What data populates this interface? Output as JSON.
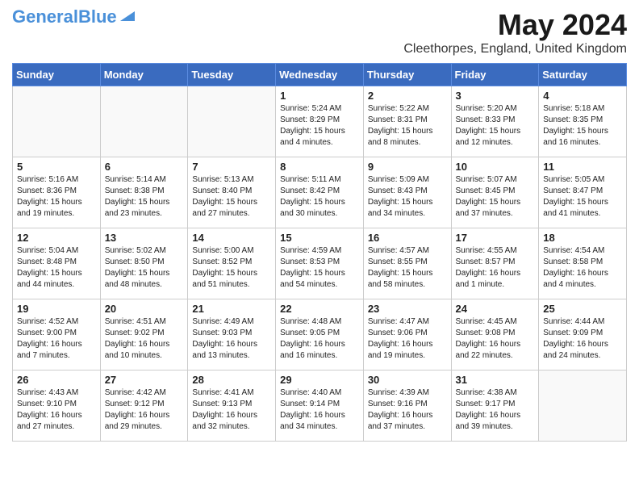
{
  "header": {
    "logo_general": "General",
    "logo_blue": "Blue",
    "month_title": "May 2024",
    "location": "Cleethorpes, England, United Kingdom"
  },
  "days_of_week": [
    "Sunday",
    "Monday",
    "Tuesday",
    "Wednesday",
    "Thursday",
    "Friday",
    "Saturday"
  ],
  "weeks": [
    [
      {
        "day": "",
        "info": ""
      },
      {
        "day": "",
        "info": ""
      },
      {
        "day": "",
        "info": ""
      },
      {
        "day": "1",
        "info": "Sunrise: 5:24 AM\nSunset: 8:29 PM\nDaylight: 15 hours\nand 4 minutes."
      },
      {
        "day": "2",
        "info": "Sunrise: 5:22 AM\nSunset: 8:31 PM\nDaylight: 15 hours\nand 8 minutes."
      },
      {
        "day": "3",
        "info": "Sunrise: 5:20 AM\nSunset: 8:33 PM\nDaylight: 15 hours\nand 12 minutes."
      },
      {
        "day": "4",
        "info": "Sunrise: 5:18 AM\nSunset: 8:35 PM\nDaylight: 15 hours\nand 16 minutes."
      }
    ],
    [
      {
        "day": "5",
        "info": "Sunrise: 5:16 AM\nSunset: 8:36 PM\nDaylight: 15 hours\nand 19 minutes."
      },
      {
        "day": "6",
        "info": "Sunrise: 5:14 AM\nSunset: 8:38 PM\nDaylight: 15 hours\nand 23 minutes."
      },
      {
        "day": "7",
        "info": "Sunrise: 5:13 AM\nSunset: 8:40 PM\nDaylight: 15 hours\nand 27 minutes."
      },
      {
        "day": "8",
        "info": "Sunrise: 5:11 AM\nSunset: 8:42 PM\nDaylight: 15 hours\nand 30 minutes."
      },
      {
        "day": "9",
        "info": "Sunrise: 5:09 AM\nSunset: 8:43 PM\nDaylight: 15 hours\nand 34 minutes."
      },
      {
        "day": "10",
        "info": "Sunrise: 5:07 AM\nSunset: 8:45 PM\nDaylight: 15 hours\nand 37 minutes."
      },
      {
        "day": "11",
        "info": "Sunrise: 5:05 AM\nSunset: 8:47 PM\nDaylight: 15 hours\nand 41 minutes."
      }
    ],
    [
      {
        "day": "12",
        "info": "Sunrise: 5:04 AM\nSunset: 8:48 PM\nDaylight: 15 hours\nand 44 minutes."
      },
      {
        "day": "13",
        "info": "Sunrise: 5:02 AM\nSunset: 8:50 PM\nDaylight: 15 hours\nand 48 minutes."
      },
      {
        "day": "14",
        "info": "Sunrise: 5:00 AM\nSunset: 8:52 PM\nDaylight: 15 hours\nand 51 minutes."
      },
      {
        "day": "15",
        "info": "Sunrise: 4:59 AM\nSunset: 8:53 PM\nDaylight: 15 hours\nand 54 minutes."
      },
      {
        "day": "16",
        "info": "Sunrise: 4:57 AM\nSunset: 8:55 PM\nDaylight: 15 hours\nand 58 minutes."
      },
      {
        "day": "17",
        "info": "Sunrise: 4:55 AM\nSunset: 8:57 PM\nDaylight: 16 hours\nand 1 minute."
      },
      {
        "day": "18",
        "info": "Sunrise: 4:54 AM\nSunset: 8:58 PM\nDaylight: 16 hours\nand 4 minutes."
      }
    ],
    [
      {
        "day": "19",
        "info": "Sunrise: 4:52 AM\nSunset: 9:00 PM\nDaylight: 16 hours\nand 7 minutes."
      },
      {
        "day": "20",
        "info": "Sunrise: 4:51 AM\nSunset: 9:02 PM\nDaylight: 16 hours\nand 10 minutes."
      },
      {
        "day": "21",
        "info": "Sunrise: 4:49 AM\nSunset: 9:03 PM\nDaylight: 16 hours\nand 13 minutes."
      },
      {
        "day": "22",
        "info": "Sunrise: 4:48 AM\nSunset: 9:05 PM\nDaylight: 16 hours\nand 16 minutes."
      },
      {
        "day": "23",
        "info": "Sunrise: 4:47 AM\nSunset: 9:06 PM\nDaylight: 16 hours\nand 19 minutes."
      },
      {
        "day": "24",
        "info": "Sunrise: 4:45 AM\nSunset: 9:08 PM\nDaylight: 16 hours\nand 22 minutes."
      },
      {
        "day": "25",
        "info": "Sunrise: 4:44 AM\nSunset: 9:09 PM\nDaylight: 16 hours\nand 24 minutes."
      }
    ],
    [
      {
        "day": "26",
        "info": "Sunrise: 4:43 AM\nSunset: 9:10 PM\nDaylight: 16 hours\nand 27 minutes."
      },
      {
        "day": "27",
        "info": "Sunrise: 4:42 AM\nSunset: 9:12 PM\nDaylight: 16 hours\nand 29 minutes."
      },
      {
        "day": "28",
        "info": "Sunrise: 4:41 AM\nSunset: 9:13 PM\nDaylight: 16 hours\nand 32 minutes."
      },
      {
        "day": "29",
        "info": "Sunrise: 4:40 AM\nSunset: 9:14 PM\nDaylight: 16 hours\nand 34 minutes."
      },
      {
        "day": "30",
        "info": "Sunrise: 4:39 AM\nSunset: 9:16 PM\nDaylight: 16 hours\nand 37 minutes."
      },
      {
        "day": "31",
        "info": "Sunrise: 4:38 AM\nSunset: 9:17 PM\nDaylight: 16 hours\nand 39 minutes."
      },
      {
        "day": "",
        "info": ""
      }
    ]
  ]
}
